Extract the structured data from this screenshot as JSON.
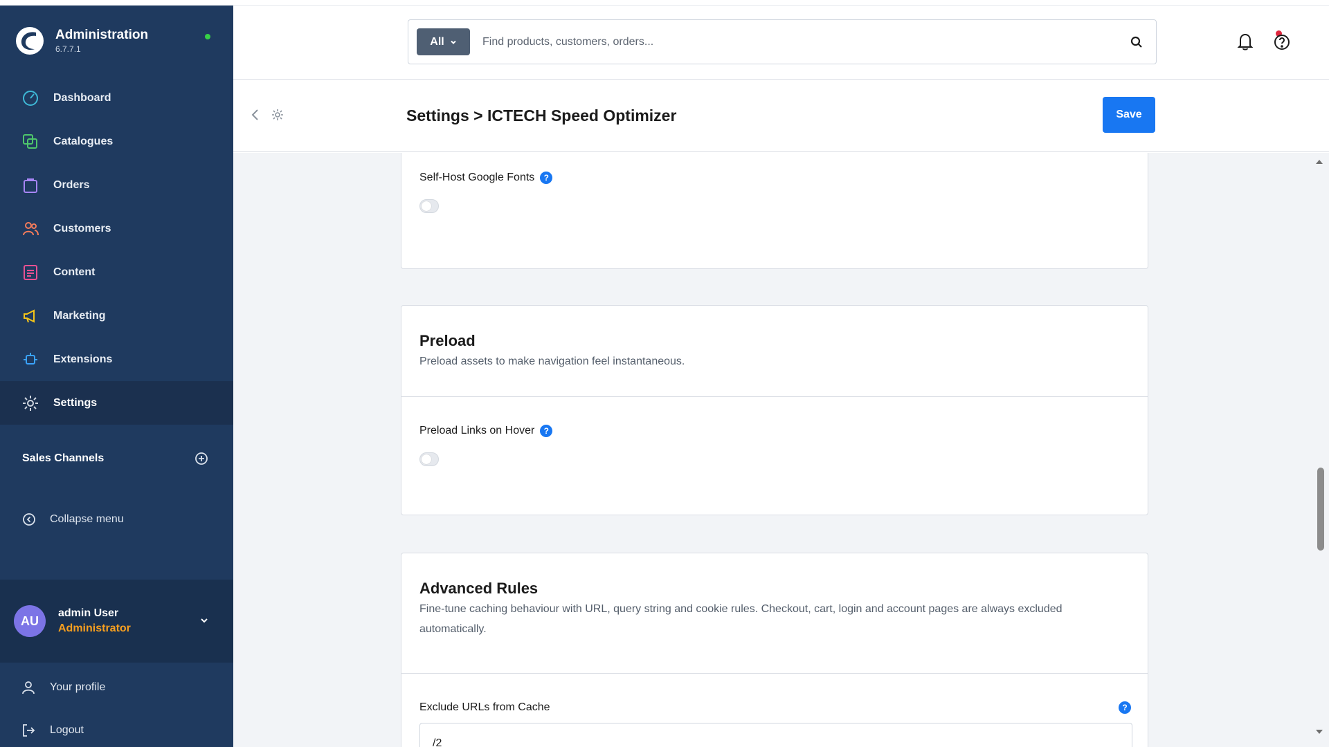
{
  "app": {
    "title": "Administration",
    "version": "6.7.7.1"
  },
  "sidebar": {
    "items": [
      {
        "label": "Dashboard",
        "icon": "dashboard-icon",
        "color": "#3eb8d6"
      },
      {
        "label": "Catalogues",
        "icon": "catalogues-icon",
        "color": "#4ec66b"
      },
      {
        "label": "Orders",
        "icon": "orders-icon",
        "color": "#a785f5"
      },
      {
        "label": "Customers",
        "icon": "customers-icon",
        "color": "#f27b5b"
      },
      {
        "label": "Content",
        "icon": "content-icon",
        "color": "#e95192"
      },
      {
        "label": "Marketing",
        "icon": "marketing-icon",
        "color": "#f5c518"
      },
      {
        "label": "Extensions",
        "icon": "extensions-icon",
        "color": "#3aa3ff"
      },
      {
        "label": "Settings",
        "icon": "settings-icon",
        "color": "#cfd6e0"
      }
    ],
    "sales_channels": "Sales Channels",
    "collapse": "Collapse menu",
    "user": {
      "initials": "AU",
      "name": "admin User",
      "role": "Administrator"
    },
    "bottom_links": [
      "Your profile",
      "Logout"
    ]
  },
  "header": {
    "search_scope": "All",
    "search_placeholder": "Find products, customers, orders..."
  },
  "subheader": {
    "title": "Settings > ICTECH Speed Optimizer",
    "save": "Save"
  },
  "cards": {
    "fonts": {
      "label": "Self-Host Google Fonts",
      "toggle_on": false
    },
    "preload": {
      "title": "Preload",
      "subtitle": "Preload assets to make navigation feel instantaneous.",
      "label": "Preload Links on Hover",
      "toggle_on": false
    },
    "advanced": {
      "title": "Advanced Rules",
      "subtitle": "Fine-tune caching behaviour with URL, query string and cookie rules. Checkout, cart, login and account pages are always excluded automatically.",
      "exclude_label": "Exclude URLs from Cache",
      "exclude_value": "/2"
    }
  },
  "colors": {
    "sidebar": "#1f3a5f",
    "accent": "#1877f2",
    "role": "#f79f1f"
  }
}
